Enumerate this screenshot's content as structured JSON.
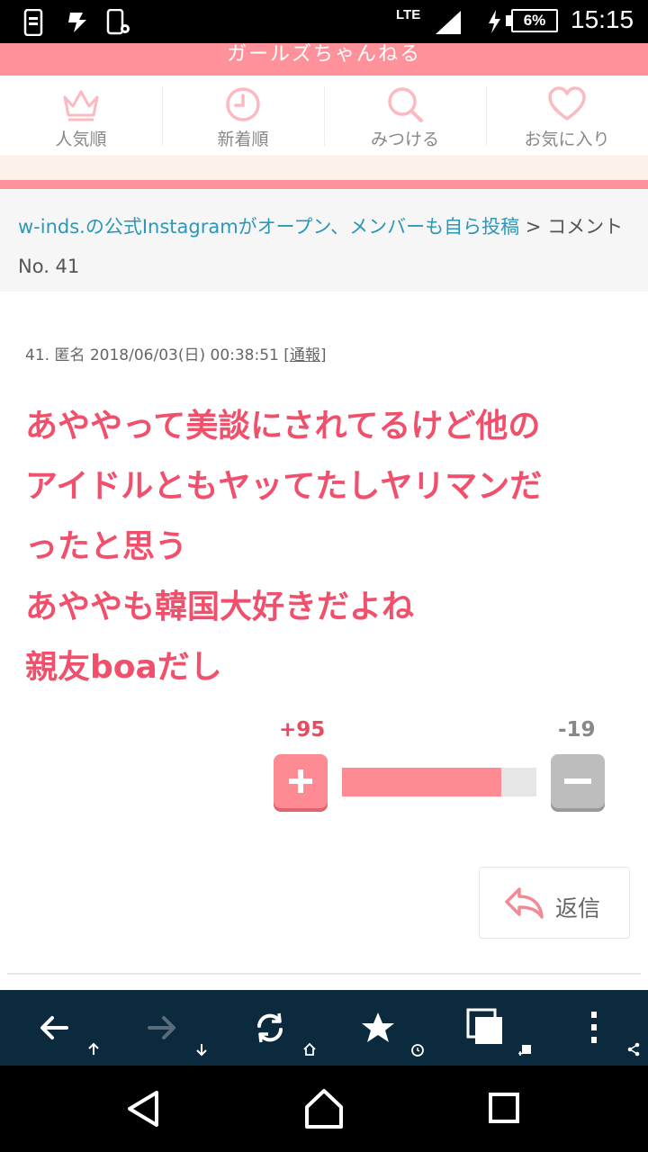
{
  "status_bar": {
    "network": "LTE",
    "battery": "6%",
    "time": "15:15"
  },
  "site": {
    "title": "ガールズちゃんねる",
    "brand_color": "#fe919a"
  },
  "nav_tabs": [
    {
      "label": "人気順",
      "icon": "crown-icon"
    },
    {
      "label": "新着順",
      "icon": "clock-icon"
    },
    {
      "label": "みつける",
      "icon": "search-icon"
    },
    {
      "label": "お気に入り",
      "icon": "heart-icon"
    }
  ],
  "breadcrumb": {
    "topic_link": "w-inds.の公式Instagramがオープン、メンバーも自ら投稿",
    "separator": " > ",
    "current": "コメント No. 41"
  },
  "comment": {
    "number": "41.",
    "author": "匿名",
    "datetime": "2018/06/03(日) 00:38:51",
    "report_open": "[",
    "report_label": "通報",
    "report_close": "]",
    "lines": [
      "あややって美談にされてるけど他の",
      "アイドルともヤッてたしヤリマンだ",
      "ったと思う",
      "あややも韓国大好きだよね",
      "親友boaだし"
    ],
    "text_color": "#f0506c"
  },
  "vote": {
    "plus_label": "+95",
    "minus_label": "-19",
    "plus_ratio": 0.82
  },
  "reply": {
    "label": "返信"
  },
  "browser_toolbar": {
    "items": [
      "back-icon",
      "forward-icon",
      "refresh-icon",
      "bookmark-star-icon",
      "tabs-icon",
      "menu-icon"
    ],
    "bg_color": "#0b2a3e"
  }
}
